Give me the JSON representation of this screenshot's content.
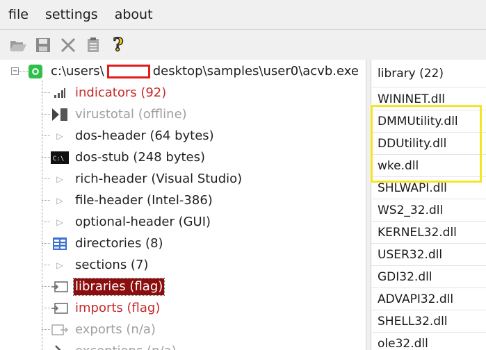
{
  "menu": {
    "items": [
      "file",
      "settings",
      "about"
    ]
  },
  "toolbar": {
    "buttons": [
      {
        "icon": "open-folder-icon"
      },
      {
        "icon": "save-icon"
      },
      {
        "icon": "close-icon"
      },
      {
        "icon": "clipboard-icon"
      },
      {
        "icon": "help-icon",
        "glyph": "?"
      }
    ]
  },
  "tree": {
    "root": {
      "path_prefix": "c:\\users\\",
      "path_suffix": "desktop\\samples\\user0\\acvb.exe"
    },
    "items": [
      {
        "label": "indicators (92)",
        "color": "#c62828"
      },
      {
        "label": "virustotal (offline)",
        "color": "#a0a0a0"
      },
      {
        "label": "dos-header (64 bytes)",
        "color": "#1f1f1f"
      },
      {
        "label": "dos-stub (248 bytes)",
        "color": "#1f1f1f",
        "icon_text": "C:\\"
      },
      {
        "label": "rich-header (Visual Studio)",
        "color": "#1f1f1f"
      },
      {
        "label": "file-header (Intel-386)",
        "color": "#1f1f1f"
      },
      {
        "label": "optional-header (GUI)",
        "color": "#1f1f1f"
      },
      {
        "label": "directories (8)",
        "color": "#1f1f1f"
      },
      {
        "label": "sections (7)",
        "color": "#1f1f1f"
      },
      {
        "label": "libraries (flag)",
        "color": "#c62828",
        "selected": true
      },
      {
        "label": "imports (flag)",
        "color": "#c62828"
      },
      {
        "label": "exports (n/a)",
        "color": "#a0a0a0"
      },
      {
        "label": "exceptions (n/a)",
        "color": "#a0a0a0"
      }
    ]
  },
  "libraries": {
    "header": "library (22)",
    "items": [
      "WININET.dll",
      "DMMUtility.dll",
      "DDUtility.dll",
      "wke.dll",
      "SHLWAPI.dll",
      "WS2_32.dll",
      "KERNEL32.dll",
      "USER32.dll",
      "GDI32.dll",
      "ADVAPI32.dll",
      "SHELL32.dll",
      "ole32.dll"
    ],
    "highlighted": [
      "DMMUtility.dll",
      "DDUtility.dll",
      "wke.dll"
    ]
  },
  "colors": {
    "selection": "#8b0d0d",
    "annotation_red": "#e41b1b",
    "annotation_yellow": "#f5e625"
  }
}
